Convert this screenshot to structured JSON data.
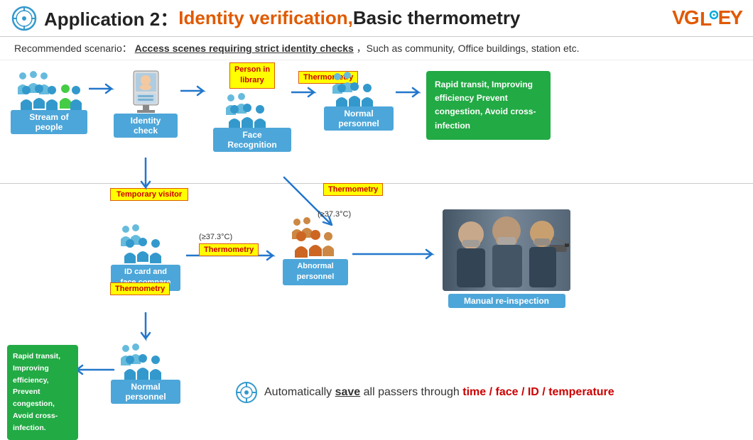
{
  "header": {
    "app_label": "Application 2：",
    "title_highlight": "Identity verification,",
    "title_rest": " Basic thermometry",
    "brand": "VGLEY"
  },
  "scenario": {
    "prefix": "Recommended scenario：",
    "highlight": "Access scenes requiring strict identity checks",
    "suffix": "，Such as community, Office buildings, station etc."
  },
  "flow": {
    "step1_label": "Stream of people",
    "step2_label": "Identity check",
    "step3_label": "Face Recognition",
    "step4_label": "Normal personnel",
    "badge_person_library": "Person in\nlibrary",
    "badge_thermometry1": "Thermometry",
    "rapid_transit_top": "Rapid transit, Improving efficiency\nPrevent congestion, Avoid cross-infection",
    "temp_visitor": "Temporary visitor",
    "badge_thermometry2": "Thermometry",
    "threshold1": "(≥37.3°C)",
    "badge_thermometry3": "Thermometry",
    "threshold2": "(≥37.3°C)",
    "step5_label": "ID card and\nface compare",
    "step6_label": "Abnormal\npersonnel",
    "step7_label": "Manual re-inspection",
    "rapid_transit_bottom": "Rapid transit,\nImproving efficiency,\nPrevent congestion,\nAvoid cross-infection.",
    "step8_label": "Normal personnel",
    "summary_save": "save",
    "summary_text_before": "Automatically ",
    "summary_text_after": " all passers through ",
    "summary_items": "time / face / ID / temperature"
  },
  "colors": {
    "accent_orange": "#e05a00",
    "accent_blue": "#4da6d9",
    "accent_green": "#22aa44",
    "accent_yellow": "#ffff00",
    "accent_red": "#cc0000",
    "arrow_blue": "#2277cc",
    "person_blue": "#3399cc",
    "person_green": "#44cc44",
    "person_orange": "#cc6600"
  }
}
